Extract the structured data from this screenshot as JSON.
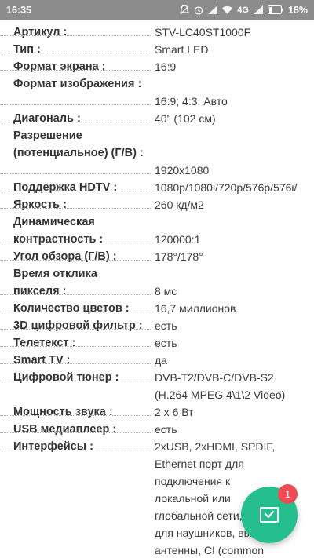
{
  "status_bar": {
    "time": "16:35",
    "network": "4G",
    "battery": "18%",
    "icons": [
      "mute-icon",
      "alarm-icon",
      "signal-icon",
      "wifi-icon",
      "network-signal-icon",
      "battery-icon"
    ]
  },
  "specs": {
    "r1": {
      "label": "Артикул :",
      "value": "STV-LC40ST1000F"
    },
    "r2": {
      "label": "Тип :",
      "value": "Smart LED"
    },
    "r3": {
      "label": "Формат экрана :",
      "value": "16:9"
    },
    "r4": {
      "label": "Формат изображения :",
      "value": "16:9; 4:3, Авто"
    },
    "r5": {
      "label": "Диагональ :",
      "value": "40\" (102 см)"
    },
    "r6": {
      "label_line1": "Разрешение",
      "label_line2": "(потенциальное) (Г/В) :",
      "value": "1920x1080"
    },
    "r7": {
      "label": "Поддержка HDTV :",
      "value": "1080p/1080i/720p/576p/576i/"
    },
    "r8": {
      "label": "Яркость :",
      "value": "260 кд/м2"
    },
    "r9": {
      "label_line1": "Динамическая",
      "label_line2": "контрастность :",
      "value": "120000:1"
    },
    "r10": {
      "label": "Угол обзора (Г/В) :",
      "value": "178°/178°"
    },
    "r11": {
      "label_line1": "Время отклика",
      "label_line2": "пикселя :",
      "value": "8 мс"
    },
    "r12": {
      "label": "Количество цветов :",
      "value": "16,7 миллионов"
    },
    "r13": {
      "label": "3D цифровой фильтр :",
      "value": "есть"
    },
    "r14": {
      "label": "Телетекст :",
      "value": "есть"
    },
    "r15": {
      "label": "Smart TV :",
      "value": "да"
    },
    "r16": {
      "label": "Цифровой тюнер :",
      "value_line1": "DVB-T2/DVB-C/DVB-S2",
      "value_line2": "(H.264 MPEG 4\\1\\2 Video)"
    },
    "r17": {
      "label": "Мощность звука :",
      "value": "2 x 6 Вт"
    },
    "r18": {
      "label": "USB медиаплеер :",
      "value": "есть"
    },
    "r19": {
      "label": "Интерфейсы :",
      "value_line1": "2xUSB, 2xHDMI, SPDIF,",
      "value_line2": "Ethernet порт для",
      "value_line3": "подключения к",
      "value_line4": "локальной или",
      "value_line5": "глобальной сети,",
      "value_line6": "для наушников, выход",
      "value_line7": "антенны, CI (common"
    }
  },
  "fab": {
    "badge_count": "1",
    "icon": "envelope-check-icon",
    "color": "#25bf8e",
    "badge_color": "#ef4b55"
  }
}
